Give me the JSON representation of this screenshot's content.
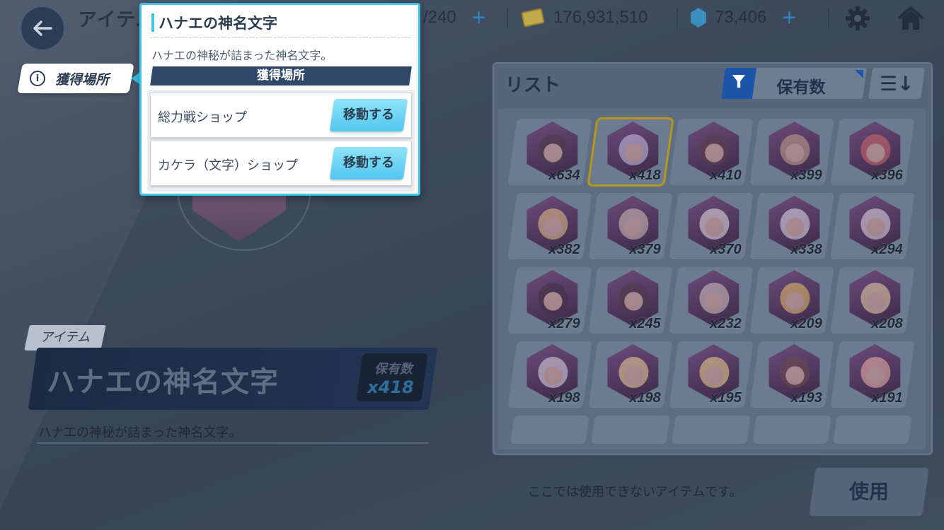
{
  "topbar": {
    "title": "アイテム",
    "ap_text": "/240",
    "credits": "176,931,510",
    "gems": "73,406"
  },
  "left": {
    "acquisition_tab": "獲得場所",
    "category_tag": "アイテム",
    "item_name": "ハナエの神名文字",
    "owned_label": "保有数",
    "owned_value": "x418",
    "item_description": "ハナエの神秘が詰まった神名文字。"
  },
  "popup": {
    "title": "ハナエの神名文字",
    "description": "ハナエの神秘が詰まった神名文字。",
    "acquisition_header": "獲得場所",
    "locations": [
      {
        "name": "総力戦ショップ",
        "button": "移動する"
      },
      {
        "name": "カケラ（文字）ショップ",
        "button": "移動する"
      }
    ]
  },
  "list": {
    "title": "リスト",
    "filter_label": "保有数",
    "items": [
      {
        "qty": "x634",
        "color": "#4a3a4a"
      },
      {
        "qty": "x418",
        "color": "#c9c3e6",
        "selected": true
      },
      {
        "qty": "x410",
        "color": "#5a3f4a"
      },
      {
        "qty": "x399",
        "color": "#c7a58a"
      },
      {
        "qty": "x396",
        "color": "#d36a6a"
      },
      {
        "qty": "x382",
        "color": "#e8c28a"
      },
      {
        "qty": "x379",
        "color": "#cfc4b8"
      },
      {
        "qty": "x370",
        "color": "#e6e2e2"
      },
      {
        "qty": "x338",
        "color": "#dfe1ee"
      },
      {
        "qty": "x294",
        "color": "#e2dce6"
      },
      {
        "qty": "x279",
        "color": "#3e3242"
      },
      {
        "qty": "x245",
        "color": "#4a3b44"
      },
      {
        "qty": "x232",
        "color": "#cfc7c2"
      },
      {
        "qty": "x209",
        "color": "#e8c36a"
      },
      {
        "qty": "x208",
        "color": "#ead6a8"
      },
      {
        "qty": "x198",
        "color": "#dedbe4"
      },
      {
        "qty": "x198",
        "color": "#f0d59a"
      },
      {
        "qty": "x195",
        "color": "#efd58e"
      },
      {
        "qty": "x193",
        "color": "#6a4a4a"
      },
      {
        "qty": "x191",
        "color": "#f0b6aa"
      }
    ]
  },
  "footer": {
    "notice": "ここでは使用できないアイテムです。",
    "use_button": "使用"
  },
  "colors": {
    "accent": "#3fc5ea",
    "navy": "#2f4869",
    "selected_border": "#b8961a"
  },
  "icons": [
    "back-arrow-icon",
    "plus-icon",
    "credit-icon",
    "gem-icon",
    "gear-icon",
    "home-icon",
    "info-icon",
    "filter-icon",
    "sort-icon"
  ]
}
